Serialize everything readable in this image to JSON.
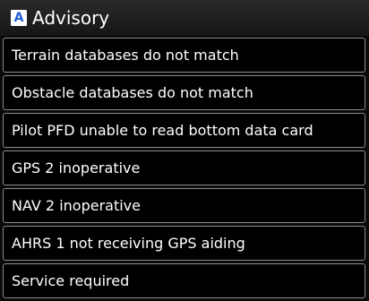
{
  "header": {
    "badge": "A",
    "title": "Advisory"
  },
  "messages": [
    "Terrain databases do not match",
    "Obstacle databases do not match",
    "Pilot PFD unable to read bottom data card",
    "GPS 2 inoperative",
    "NAV 2 inoperative",
    "AHRS 1 not receiving GPS aiding",
    "Service required"
  ],
  "colors": {
    "background": "#000000",
    "header_background": "#1e1e1e",
    "row_border": "#8c8c8c",
    "text": "#ffffff",
    "badge_letter": "#1f5fd6"
  }
}
